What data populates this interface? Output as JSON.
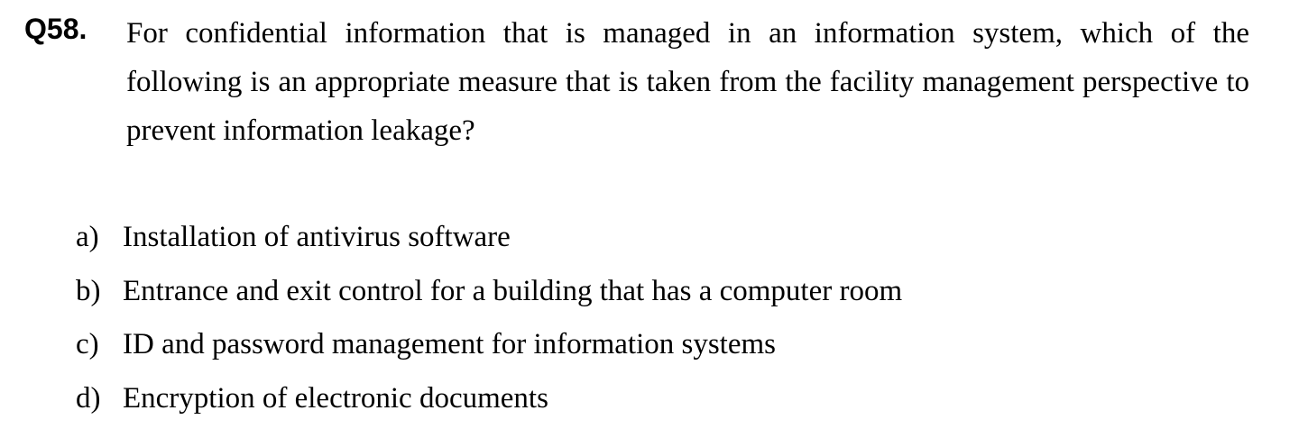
{
  "question": {
    "number": "Q58.",
    "text": "For confidential information that is managed in an information system, which of the following is an appropriate measure that is taken from the facility management perspective to prevent information leakage?"
  },
  "options": [
    {
      "letter": "a)",
      "text": "Installation of antivirus software"
    },
    {
      "letter": "b)",
      "text": "Entrance and exit control for a building that has a computer room"
    },
    {
      "letter": "c)",
      "text": "ID and password management for information systems"
    },
    {
      "letter": "d)",
      "text": "Encryption of electronic documents"
    }
  ]
}
